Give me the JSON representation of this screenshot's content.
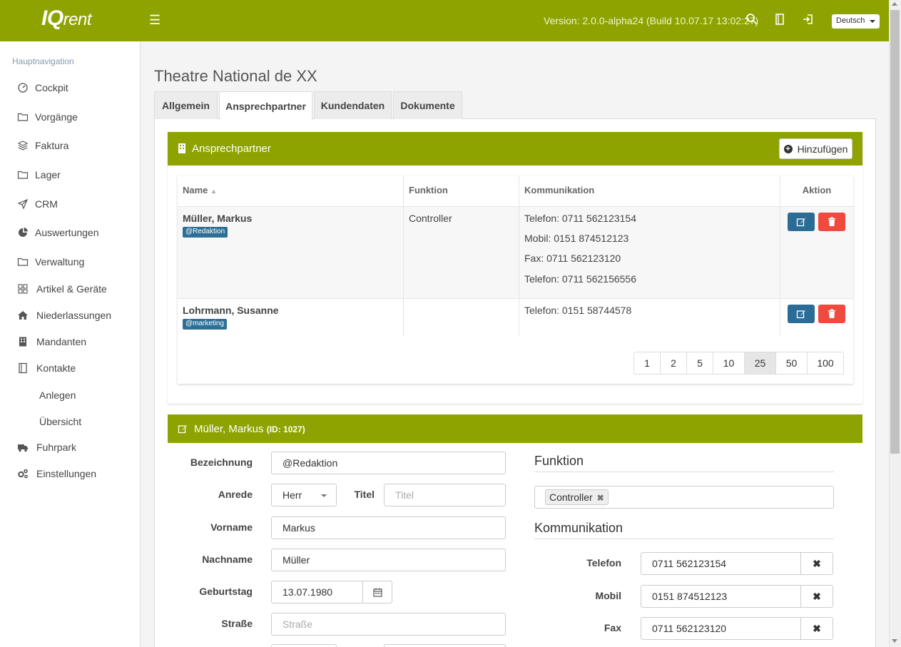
{
  "header": {
    "logo_main": "IQ",
    "logo_sub": "rent",
    "version": "Version: 2.0.0-alpha24 (Build 10.07.17 13:02:27)",
    "language": "Deutsch"
  },
  "sidebar": {
    "title": "Hauptnavigation",
    "items": [
      {
        "label": "Cockpit",
        "icon": "gauge-icon"
      },
      {
        "label": "Vorgänge",
        "icon": "folder-icon"
      },
      {
        "label": "Faktura",
        "icon": "layers-icon"
      },
      {
        "label": "Lager",
        "icon": "folder-icon"
      },
      {
        "label": "CRM",
        "icon": "paper-plane-icon"
      },
      {
        "label": "Auswertungen",
        "icon": "pie-chart-icon"
      },
      {
        "label": "Verwaltung",
        "icon": "folder-icon"
      },
      {
        "label": "Artikel & Geräte",
        "icon": "grid-icon"
      },
      {
        "label": "Niederlassungen",
        "icon": "home-icon"
      },
      {
        "label": "Mandanten",
        "icon": "building-icon"
      },
      {
        "label": "Kontakte",
        "icon": "address-book-icon"
      },
      {
        "label": "Fuhrpark",
        "icon": "truck-icon"
      },
      {
        "label": "Einstellungen",
        "icon": "cogs-icon"
      }
    ],
    "sub_items": [
      "Anlegen",
      "Übersicht"
    ]
  },
  "page": {
    "title": "Theatre National de XX",
    "tabs": [
      "Allgemein",
      "Ansprechpartner",
      "Kundendaten",
      "Dokumente"
    ],
    "active_tab": "Ansprechpartner"
  },
  "contacts_panel": {
    "title": "Ansprechpartner",
    "add_label": "Hinzufügen",
    "columns": [
      "Name",
      "Funktion",
      "Kommunikation",
      "Aktion"
    ],
    "rows": [
      {
        "name": "Müller, Markus",
        "badge": "@Redaktion",
        "function": "Controller",
        "communication": [
          "Telefon: 0711 562123154",
          "Mobil: 0151 874512123",
          "Fax: 0711 562123120",
          "Telefon: 0711 562156556"
        ]
      },
      {
        "name": "Lohrmann, Susanne",
        "badge": "@marketing",
        "function": "",
        "communication": [
          "Telefon: 0151 58744578"
        ]
      }
    ],
    "page_sizes": [
      "1",
      "2",
      "5",
      "10",
      "25",
      "50",
      "100"
    ],
    "active_page_size": "25"
  },
  "edit_panel": {
    "title": "Müller, Markus",
    "id_label": "(ID: 1027)",
    "fields": {
      "bezeichnung": {
        "label": "Bezeichnung",
        "value": "@Redaktion"
      },
      "anrede": {
        "label": "Anrede",
        "value": "Herr"
      },
      "titel": {
        "label": "Titel",
        "placeholder": "Titel"
      },
      "vorname": {
        "label": "Vorname",
        "value": "Markus"
      },
      "nachname": {
        "label": "Nachname",
        "value": "Müller"
      },
      "geburtstag": {
        "label": "Geburtstag",
        "value": "13.07.1980"
      },
      "strasse": {
        "label": "Straße",
        "placeholder": "Straße"
      }
    },
    "funktion_title": "Funktion",
    "funktion_tag": "Controller",
    "kommunikation_title": "Kommunikation",
    "kommunikation": [
      {
        "label": "Telefon",
        "value": "0711 562123154"
      },
      {
        "label": "Mobil",
        "value": "0151 874512123"
      },
      {
        "label": "Fax",
        "value": "0711 562123120"
      }
    ]
  }
}
